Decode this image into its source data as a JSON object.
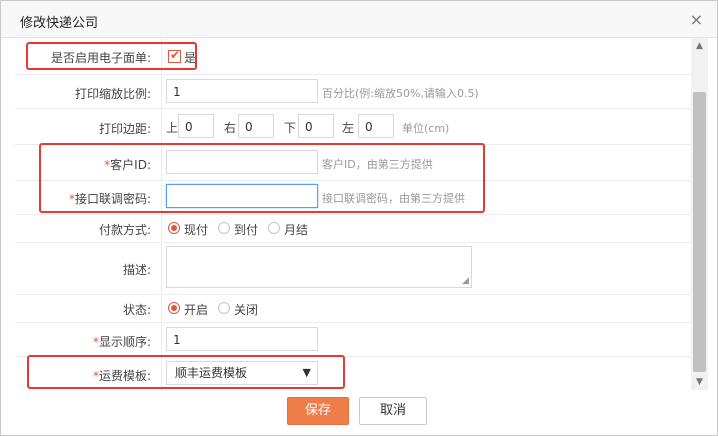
{
  "dialog": {
    "title": "修改快递公司",
    "close_glyph": "×"
  },
  "form": {
    "electronic": {
      "label": "是否启用电子面单:",
      "checked": true,
      "option": "是"
    },
    "scale": {
      "label": "打印缩放比例:",
      "value": "1",
      "hint": "百分比(例:缩放50%,请输入0.5)"
    },
    "margin": {
      "label": "打印边距:",
      "top_label": "上",
      "top": "0",
      "right_label": "右",
      "right": "0",
      "bottom_label": "下",
      "bottom": "0",
      "left_label": "左",
      "left": "0",
      "unit_hint": "单位(cm)"
    },
    "customer_id": {
      "required": "*",
      "label": "客户ID:",
      "value": "",
      "hint": "客户ID，由第三方提供"
    },
    "api_password": {
      "required": "*",
      "label": "接口联调密码:",
      "value": "",
      "hint": "接口联调密码，由第三方提供"
    },
    "payment": {
      "label": "付款方式:",
      "options": [
        "现付",
        "到付",
        "月结"
      ],
      "selected": "现付"
    },
    "description": {
      "label": "描述:",
      "value": ""
    },
    "status": {
      "label": "状态:",
      "options": [
        "开启",
        "关闭"
      ],
      "selected": "开启"
    },
    "order": {
      "required": "*",
      "label": "显示顺序:",
      "value": "1"
    },
    "template": {
      "required": "*",
      "label": "运费模板:",
      "selected": "顺丰运费模板"
    }
  },
  "buttons": {
    "save": "保存",
    "cancel": "取消"
  },
  "colors": {
    "accent": "#ee7d4a",
    "radio_on": "#e0573d",
    "highlight": "#e53935"
  },
  "icons": {
    "close": "close-icon",
    "check": "check-icon",
    "dropdown": "chevron-down-icon",
    "scroll_up": "scroll-up-icon",
    "scroll_down": "scroll-down-icon"
  }
}
